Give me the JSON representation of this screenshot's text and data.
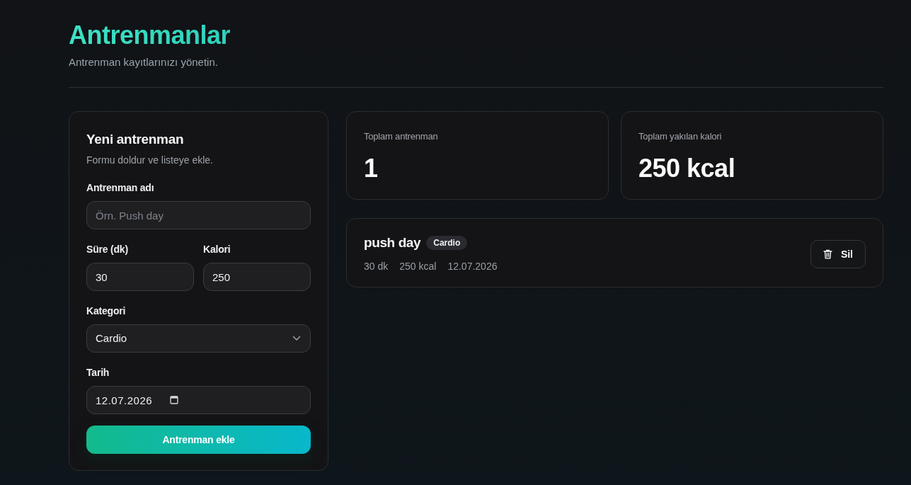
{
  "header": {
    "title": "Antrenmanlar",
    "subtitle": "Antrenman kayıtlarınızı yönetin."
  },
  "form": {
    "title": "Yeni antrenman",
    "subtitle": "Formu doldur ve listeye ekle.",
    "rows": [
      [
        {
          "kind": "text",
          "label": "Antrenman adı",
          "placeholder": "Örn. Push day"
        }
      ],
      [
        {
          "kind": "number",
          "label": "Süre (dk)",
          "value": "30"
        },
        {
          "kind": "number",
          "label": "Kalori",
          "value": "250"
        }
      ],
      [
        {
          "kind": "select",
          "label": "Kategori",
          "value": "Cardio"
        }
      ],
      [
        {
          "kind": "date",
          "label": "Tarih",
          "value": "12.07.2026"
        }
      ]
    ],
    "submit": "Antrenman ekle"
  },
  "stats": [
    {
      "label": "Toplam antrenman",
      "value": "1"
    },
    {
      "label": "Toplam yakılan kalori",
      "value": "250 kcal"
    }
  ],
  "workouts": [
    {
      "name": "push day",
      "category": "Cardio",
      "duration": "30 dk",
      "calories": "250 kcal",
      "date": "12.07.2026",
      "delete_label": "Sil"
    }
  ]
}
